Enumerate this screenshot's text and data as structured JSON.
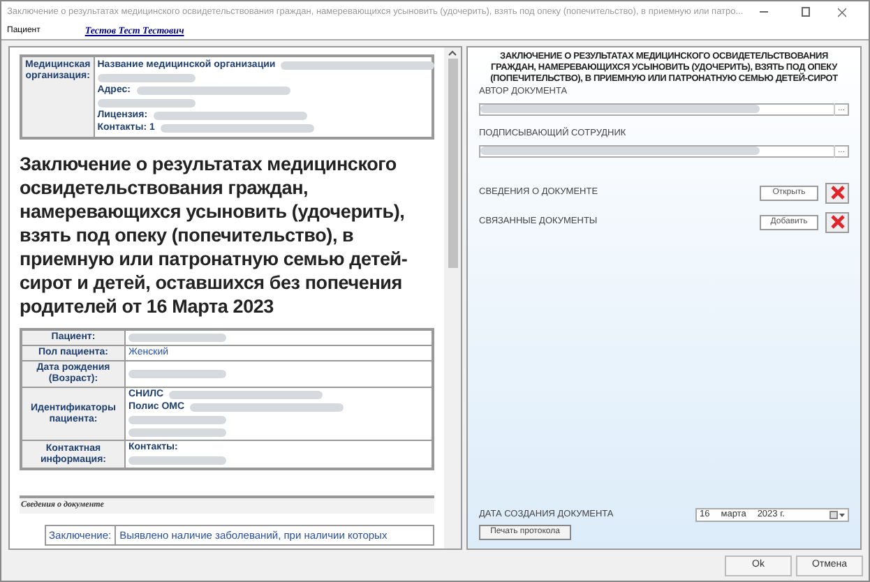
{
  "window": {
    "title": "Заключение о результатах медицинского освидетельствования граждан, намеревающихся усыновить (удочерить), взять под опеку (попечительство), в приемную или патро..."
  },
  "patient_bar": {
    "label": "Пациент",
    "name": "Тестов Тест Тестович"
  },
  "document": {
    "org_table": {
      "label": "Медицинская организация:",
      "lines": [
        {
          "kind": "labeled_redacted",
          "label": "Название медицинской организации"
        },
        {
          "kind": "redacted"
        },
        {
          "kind": "labeled_redacted",
          "label": "Адрес:"
        },
        {
          "kind": "redacted"
        },
        {
          "kind": "labeled_redacted",
          "label": "Лицензия:"
        },
        {
          "kind": "labeled_redacted",
          "label": "Контакты: 1"
        }
      ]
    },
    "heading": "Заключение о результатах медицинского освидетельствования граждан, намеревающихся усыновить (удочерить), взять под опеку (попечительство), в приемную или патронатную семью детей-сирот и детей, оставшихся без попечения родителей от 16 Марта 2023",
    "patient_rows": [
      {
        "label": "Пациент:",
        "lines": [
          {
            "kind": "redacted"
          }
        ]
      },
      {
        "label": "Пол пациента:",
        "lines": [
          {
            "kind": "text",
            "text": "Женский"
          }
        ]
      },
      {
        "label": "Дата рождения (Возраст):",
        "lines": [
          {
            "kind": "redacted"
          }
        ]
      },
      {
        "label": "Идентификаторы пациента:",
        "lines": [
          {
            "kind": "labeled_redacted",
            "text": "СНИЛС"
          },
          {
            "kind": "labeled_redacted",
            "text": "Полис ОМС"
          },
          {
            "kind": "redacted"
          },
          {
            "kind": "redacted"
          }
        ]
      },
      {
        "label": "Контактная информация:",
        "lines": [
          {
            "kind": "label",
            "text": "Контакты:"
          },
          {
            "kind": "redacted"
          }
        ]
      }
    ],
    "section_title": "Сведения о документе",
    "conclusion": {
      "label": "Заключение:",
      "value": "Выявлено наличие заболеваний, при наличии которых"
    }
  },
  "side": {
    "title": "ЗАКЛЮЧЕНИЕ О РЕЗУЛЬТАТАХ МЕДИЦИНСКОГО ОСВИДЕТЕЛЬСТВОВАНИЯ ГРАЖДАН, НАМЕРЕВАЮЩИХСЯ УСЫНОВИТЬ (УДОЧЕРИТЬ), ВЗЯТЬ ПОД ОПЕКУ (ПОПЕЧИТЕЛЬСТВО), В ПРИЕМНУЮ ИЛИ ПАТРОНАТНУЮ СЕМЬЮ ДЕТЕЙ-СИРОТ",
    "pickers": [
      {
        "label": "АВТОР ДОКУМЕНТА",
        "button": "..."
      },
      {
        "label": "ПОДПИСЫВАЮЩИЙ СОТРУДНИК",
        "button": "..."
      }
    ],
    "doc_rows": [
      {
        "label": "СВЕДЕНИЯ О ДОКУМЕНТЕ",
        "button": "Открыть"
      },
      {
        "label": "СВЯЗАННЫЕ ДОКУМЕНТЫ",
        "button": "Добавить"
      }
    ],
    "date_label": "ДАТА СОЗДАНИЯ ДОКУМЕНТА",
    "date": [
      "16",
      "марта",
      "2023 г."
    ],
    "print_button": "Печать протокола"
  },
  "buttons": [
    "Ok",
    "Отмена"
  ]
}
